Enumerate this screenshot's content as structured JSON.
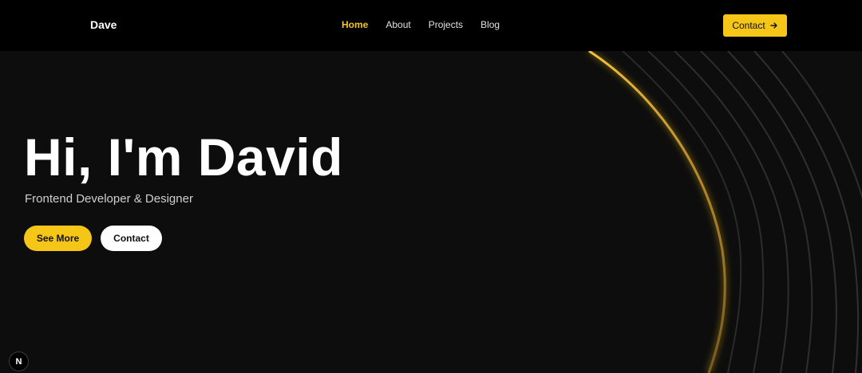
{
  "navbar": {
    "brand": "Dave",
    "links": [
      {
        "label": "Home",
        "active": true
      },
      {
        "label": "About",
        "active": false
      },
      {
        "label": "Projects",
        "active": false
      },
      {
        "label": "Blog",
        "active": false
      }
    ],
    "contact_label": "Contact",
    "contact_icon": "arrow-right-icon"
  },
  "hero": {
    "title": "Hi, I'm David",
    "subtitle": "Frontend Developer & Designer",
    "primary_button": "See More",
    "secondary_button": "Contact"
  },
  "dev_indicator": {
    "label": "N"
  },
  "colors": {
    "background": "#0d0d0d",
    "navbar": "#000000",
    "accent": "#f5c518",
    "curve_gold": "#c8952a",
    "curve_gray": "#2e2e2e"
  }
}
